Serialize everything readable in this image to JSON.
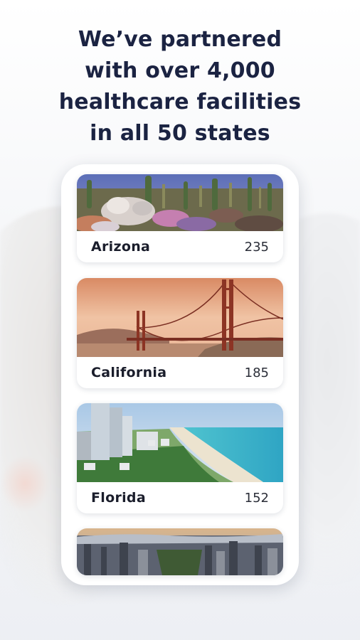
{
  "headline": {
    "lines": [
      "We’ve partnered",
      "with over 4,000",
      "healthcare facilities",
      "in all 50 states"
    ]
  },
  "states": [
    {
      "name": "Arizona",
      "count": "235",
      "image": "desert-cactus-photo"
    },
    {
      "name": "California",
      "count": "185",
      "image": "golden-gate-bridge-photo"
    },
    {
      "name": "Florida",
      "count": "152",
      "image": "miami-beach-photo"
    },
    {
      "name": "",
      "count": "",
      "image": "new-york-skyline-photo"
    }
  ],
  "colors": {
    "headline": "#1b2342",
    "card_background": "#ffffff",
    "text_primary": "#1a1d2b"
  }
}
